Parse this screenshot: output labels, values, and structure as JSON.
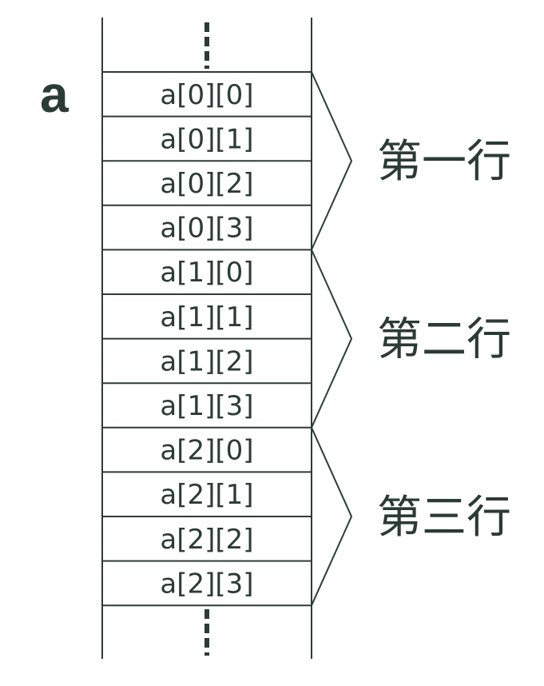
{
  "array_name": "a",
  "continuation_glyph": "⋮",
  "cells": [
    "a[0][0]",
    "a[0][1]",
    "a[0][2]",
    "a[0][3]",
    "a[1][0]",
    "a[1][1]",
    "a[1][2]",
    "a[1][3]",
    "a[2][0]",
    "a[2][1]",
    "a[2][2]",
    "a[2][3]"
  ],
  "groups": [
    {
      "label": "第一行",
      "first_cell": 0,
      "last_cell": 3
    },
    {
      "label": "第二行",
      "first_cell": 4,
      "last_cell": 7
    },
    {
      "label": "第三行",
      "first_cell": 8,
      "last_cell": 11
    }
  ],
  "colors": {
    "ink": "#2b3b36",
    "background": "#ffffff"
  }
}
